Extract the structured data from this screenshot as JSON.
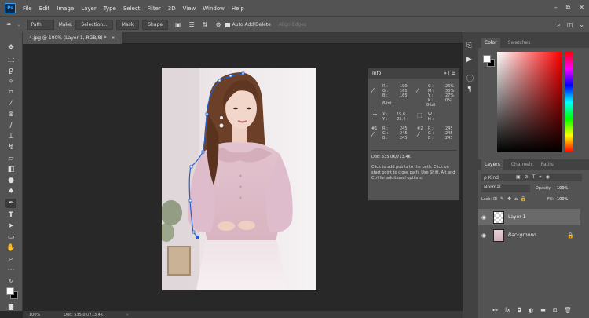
{
  "app": {
    "logo": "Ps"
  },
  "menu": [
    "File",
    "Edit",
    "Image",
    "Layer",
    "Type",
    "Select",
    "Filter",
    "3D",
    "View",
    "Window",
    "Help"
  ],
  "window_controls": [
    "–",
    "⧉",
    "✕"
  ],
  "options": {
    "mode_value": "Path",
    "make_label": "Make:",
    "selection_btn": "Selection...",
    "mask_btn": "Mask",
    "shape_btn": "Shape",
    "auto_add_delete": "Auto Add/Delete",
    "align_edges": "Align Edges"
  },
  "document_tab": {
    "title": "4.jpg @ 100% (Layer 1, RGB/8) *",
    "close": "×"
  },
  "status": {
    "zoom": "100%",
    "doc": "Doc: 535.0K/713.4K",
    "arrow": "›"
  },
  "info": {
    "tab": "Info",
    "rgb_labels": [
      "R :",
      "G :",
      "B :"
    ],
    "rgb_values": [
      "190",
      "161",
      "165"
    ],
    "cmyk_labels": [
      "C :",
      "M :",
      "Y :",
      "K :"
    ],
    "cmyk_values": [
      "26%",
      "36%",
      "27%",
      "0%"
    ],
    "bit_left": "8-bit",
    "bit_right": "8-bit",
    "xy_labels": [
      "X :",
      "Y :"
    ],
    "xy_values": [
      "19.6",
      "23.4"
    ],
    "wh_labels": [
      "W :",
      "H :"
    ],
    "s1_label": "#1",
    "s1_labels": [
      "R :",
      "G :",
      "B :"
    ],
    "s1_values": [
      "245",
      "245",
      "245"
    ],
    "s2_label": "#2",
    "s2_labels": [
      "R :",
      "G :",
      "B :"
    ],
    "s2_values": [
      "245",
      "245",
      "245"
    ],
    "doc": "Doc: 535.0K/713.4K",
    "help": "Click to add points to the path.  Click on start point to close path.  Use Shift, Alt and Ctrl for additional options."
  },
  "color_panel": {
    "tabs": [
      "Color",
      "Swatches"
    ]
  },
  "layers_panel": {
    "tabs": [
      "Layers",
      "Channels",
      "Paths"
    ],
    "kind_label": "ρ Kind",
    "blend_mode": "Normal",
    "opacity_label": "Opacity:",
    "opacity_value": "100%",
    "lock_label": "Lock:",
    "fill_label": "Fill:",
    "fill_value": "100%",
    "layers": [
      {
        "name": "Layer 1",
        "selected": true
      },
      {
        "name": "Background",
        "selected": false
      }
    ]
  },
  "colors": {
    "accent": "#31a8ff",
    "path": "#1f5fd0"
  }
}
